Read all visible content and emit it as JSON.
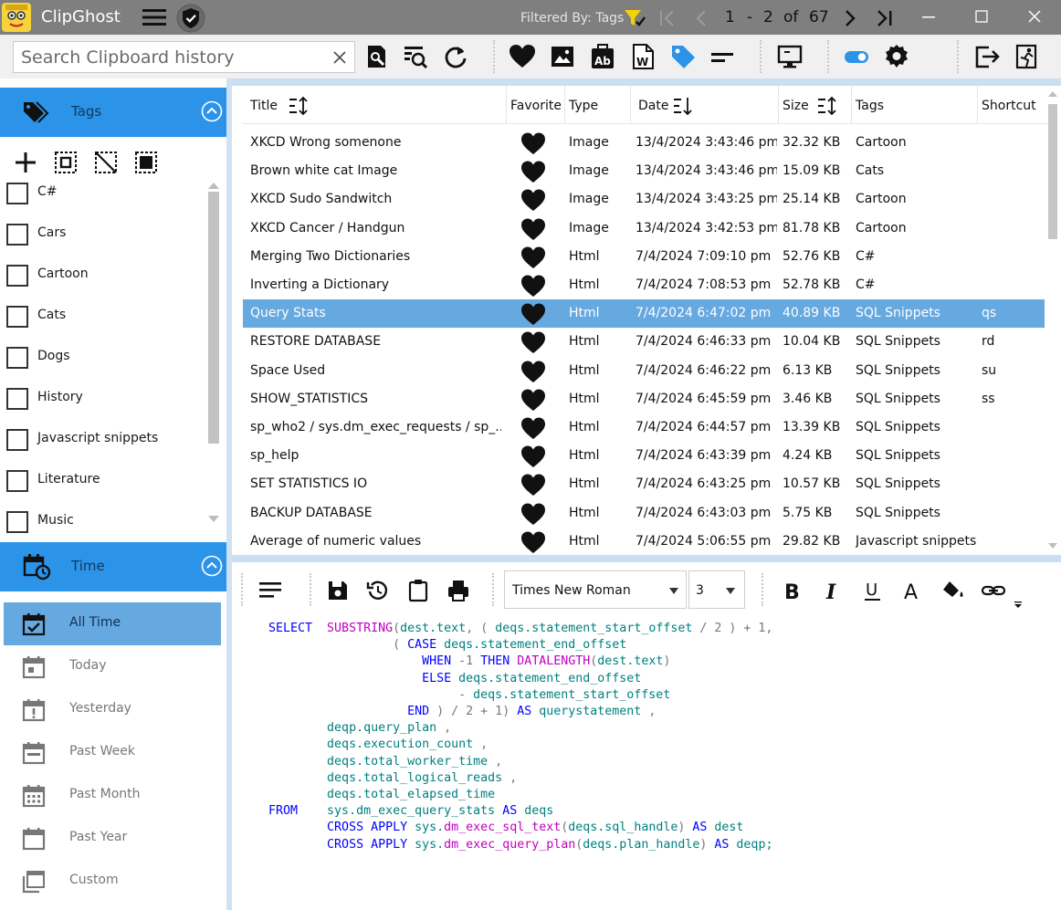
{
  "app": {
    "name": "ClipGhost",
    "filter_label": "Filtered By: Tags",
    "page_current": "1",
    "page_sep": "-",
    "page_current2": "2",
    "page_of": "of",
    "page_total": "67"
  },
  "search": {
    "placeholder": "Search Clipboard history",
    "value": ""
  },
  "colors": {
    "accent": "#2b93e8",
    "selection": "#66a8e0",
    "titlebar": "#7f7f7f"
  },
  "tags_section": {
    "title": "Tags",
    "items": [
      {
        "label": "C#",
        "checked": false
      },
      {
        "label": "Cars",
        "checked": false
      },
      {
        "label": "Cartoon",
        "checked": false
      },
      {
        "label": "Cats",
        "checked": false
      },
      {
        "label": "Dogs",
        "checked": false
      },
      {
        "label": "History",
        "checked": false
      },
      {
        "label": "Javascript snippets",
        "checked": false
      },
      {
        "label": "Literature",
        "checked": false
      },
      {
        "label": "Music",
        "checked": false
      }
    ]
  },
  "time_section": {
    "title": "Time",
    "items": [
      {
        "label": "All Time",
        "icon": "calendar-check-icon",
        "selected": true
      },
      {
        "label": "Today",
        "icon": "calendar-day-icon",
        "selected": false
      },
      {
        "label": "Yesterday",
        "icon": "calendar-alert-icon",
        "selected": false
      },
      {
        "label": "Past Week",
        "icon": "calendar-week-icon",
        "selected": false
      },
      {
        "label": "Past Month",
        "icon": "calendar-month-icon",
        "selected": false
      },
      {
        "label": "Past Year",
        "icon": "calendar-year-icon",
        "selected": false
      },
      {
        "label": "Custom",
        "icon": "calendar-custom-icon",
        "selected": false
      }
    ]
  },
  "table": {
    "headers": {
      "title": "Title",
      "favorite": "Favorite",
      "type": "Type",
      "date": "Date",
      "size": "Size",
      "tags": "Tags",
      "shortcut": "Shortcut"
    },
    "rows": [
      {
        "title": "XKCD Wrong somenone",
        "type": "Image",
        "date": "13/4/2024 3:43:46 pm",
        "size": "32.32 KB",
        "tags": "Cartoon",
        "shortcut": "",
        "favorite": true
      },
      {
        "title": "Brown white cat Image",
        "type": "Image",
        "date": "13/4/2024 3:43:46 pm",
        "size": "15.09 KB",
        "tags": "Cats",
        "shortcut": "",
        "favorite": true
      },
      {
        "title": "XKCD Sudo Sandwitch",
        "type": "Image",
        "date": "13/4/2024 3:43:25 pm",
        "size": "25.14 KB",
        "tags": "Cartoon",
        "shortcut": "",
        "favorite": true
      },
      {
        "title": "XKCD Cancer / Handgun",
        "type": "Image",
        "date": "13/4/2024 3:42:53 pm",
        "size": "81.78 KB",
        "tags": "Cartoon",
        "shortcut": "",
        "favorite": true
      },
      {
        "title": "Merging Two Dictionaries",
        "type": "Html",
        "date": "7/4/2024 7:09:10 pm",
        "size": "52.76 KB",
        "tags": "C#",
        "shortcut": "",
        "favorite": true
      },
      {
        "title": "Inverting a Dictionary",
        "type": "Html",
        "date": "7/4/2024 7:08:53 pm",
        "size": "52.78 KB",
        "tags": "C#",
        "shortcut": "",
        "favorite": true
      },
      {
        "title": "Query Stats",
        "type": "Html",
        "date": "7/4/2024 6:47:02 pm",
        "size": "40.89 KB",
        "tags": "SQL Snippets",
        "shortcut": "qs",
        "favorite": true,
        "selected": true
      },
      {
        "title": "RESTORE DATABASE",
        "type": "Html",
        "date": "7/4/2024 6:46:33 pm",
        "size": "10.04 KB",
        "tags": "SQL Snippets",
        "shortcut": "rd",
        "favorite": true
      },
      {
        "title": "Space Used",
        "type": "Html",
        "date": "7/4/2024 6:46:22 pm",
        "size": "6.13 KB",
        "tags": "SQL Snippets",
        "shortcut": "su",
        "favorite": true
      },
      {
        "title": " SHOW_STATISTICS",
        "type": "Html",
        "date": "7/4/2024 6:45:59 pm",
        "size": "3.46 KB",
        "tags": "SQL Snippets",
        "shortcut": "ss",
        "favorite": true
      },
      {
        "title": "sp_who2 / sys.dm_exec_requests / sp_...",
        "type": "Html",
        "date": "7/4/2024 6:44:57 pm",
        "size": "13.39 KB",
        "tags": "SQL Snippets",
        "shortcut": "",
        "favorite": true
      },
      {
        "title": "sp_help",
        "type": "Html",
        "date": "7/4/2024 6:43:39 pm",
        "size": "4.24 KB",
        "tags": "SQL Snippets",
        "shortcut": "",
        "favorite": true
      },
      {
        "title": "SET STATISTICS IO",
        "type": "Html",
        "date": "7/4/2024 6:43:25 pm",
        "size": "10.57 KB",
        "tags": "SQL Snippets",
        "shortcut": "",
        "favorite": true
      },
      {
        "title": "BACKUP DATABASE",
        "type": "Html",
        "date": "7/4/2024 6:43:03 pm",
        "size": "5.75 KB",
        "tags": "SQL Snippets",
        "shortcut": "",
        "favorite": true
      },
      {
        "title": "Average of numeric values",
        "type": "Html",
        "date": "7/4/2024 5:06:55 pm",
        "size": "29.82 KB",
        "tags": "Javascript snippets",
        "shortcut": "",
        "favorite": true
      }
    ]
  },
  "editor": {
    "font": "Times New Roman",
    "size": "3",
    "code_lines": [
      [
        [
          "kw",
          "SELECT  "
        ],
        [
          "fn",
          "SUBSTRING"
        ],
        [
          "op",
          "("
        ],
        [
          "id",
          "dest.text"
        ],
        [
          "op",
          ", ( "
        ],
        [
          "id",
          "deqs.statement_start_offset"
        ],
        [
          "op",
          " / 2 ) + 1,"
        ]
      ],
      [
        [
          "op",
          "                 ( "
        ],
        [
          "kw",
          "CASE "
        ],
        [
          "id",
          "deqs.statement_end_offset"
        ]
      ],
      [
        [
          "op",
          "                     "
        ],
        [
          "kw",
          "WHEN "
        ],
        [
          "op",
          "-1 "
        ],
        [
          "kw",
          "THEN "
        ],
        [
          "fn",
          "DATALENGTH"
        ],
        [
          "op",
          "("
        ],
        [
          "id",
          "dest.text"
        ],
        [
          "op",
          ")"
        ]
      ],
      [
        [
          "op",
          "                     "
        ],
        [
          "kw",
          "ELSE "
        ],
        [
          "id",
          "deqs.statement_end_offset"
        ]
      ],
      [
        [
          "op",
          "                          - "
        ],
        [
          "id",
          "deqs.statement_start_offset"
        ]
      ],
      [
        [
          "op",
          "                   "
        ],
        [
          "kw",
          "END "
        ],
        [
          "op",
          ") / 2 + 1) "
        ],
        [
          "kw",
          "AS "
        ],
        [
          "id",
          "querystatement "
        ],
        [
          "op",
          ","
        ]
      ],
      [
        [
          "op",
          "        "
        ],
        [
          "id",
          "deqp.query_plan "
        ],
        [
          "op",
          ","
        ]
      ],
      [
        [
          "op",
          "        "
        ],
        [
          "id",
          "deqs.execution_count "
        ],
        [
          "op",
          ","
        ]
      ],
      [
        [
          "op",
          "        "
        ],
        [
          "id",
          "deqs.total_worker_time "
        ],
        [
          "op",
          ","
        ]
      ],
      [
        [
          "op",
          "        "
        ],
        [
          "id",
          "deqs.total_logical_reads "
        ],
        [
          "op",
          ","
        ]
      ],
      [
        [
          "op",
          "        "
        ],
        [
          "id",
          "deqs.total_elapsed_time"
        ]
      ],
      [
        [
          "kw",
          "FROM    "
        ],
        [
          "id",
          "sys.dm_exec_query_stats "
        ],
        [
          "kw",
          "AS "
        ],
        [
          "id",
          "deqs"
        ]
      ],
      [
        [
          "op",
          "        "
        ],
        [
          "kw",
          "CROSS APPLY "
        ],
        [
          "id",
          "sys."
        ],
        [
          "fn",
          "dm_exec_sql_text"
        ],
        [
          "op",
          "("
        ],
        [
          "id",
          "deqs.sql_handle"
        ],
        [
          "op",
          ") "
        ],
        [
          "kw",
          "AS "
        ],
        [
          "id",
          "dest"
        ]
      ],
      [
        [
          "op",
          "        "
        ],
        [
          "kw",
          "CROSS APPLY "
        ],
        [
          "id",
          "sys."
        ],
        [
          "fn",
          "dm_exec_query_plan"
        ],
        [
          "op",
          "("
        ],
        [
          "id",
          "deqs.plan_handle"
        ],
        [
          "op",
          ") "
        ],
        [
          "kw",
          "AS "
        ],
        [
          "id",
          "deqp;"
        ]
      ]
    ]
  }
}
